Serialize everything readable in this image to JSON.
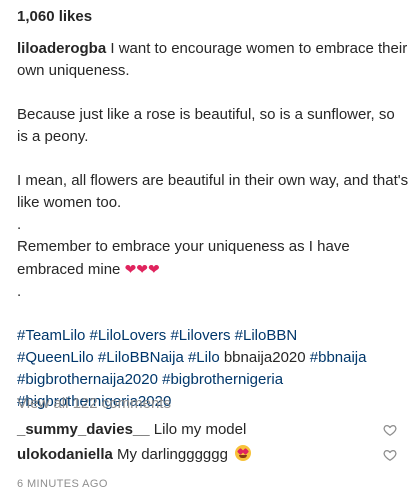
{
  "post": {
    "likes": "1,060 likes",
    "caption": {
      "username": "liloaderogba",
      "line1": " I want to encourage women to embrace their own uniqueness.",
      "line2": "Because just like a rose is beautiful, so is a sunflower, so is a peony.",
      "line3": "I mean, all flowers are beautiful in their own way, and that's like women too.",
      "dot1": ".",
      "line4": "Remember to embrace your uniqueness as I have embraced mine ",
      "hearts": "❤❤❤",
      "dot2": ".",
      "hashtags": [
        "#TeamLilo",
        "#LiloLovers",
        "#Lilovers",
        "#LiloBBN",
        "#QueenLilo",
        "#LiloBBNaija",
        "#Lilo",
        "bbnaija2020",
        "#bbnaija",
        "#bigbrothernaija2020",
        "#bigbrothernigeria",
        "#bigbrothernigeria2020"
      ]
    },
    "view_all_comments": "View all 122 comments",
    "comments": [
      {
        "username": "_summy_davies__",
        "text": "Lilo my model",
        "like_icon": "heart-outline-icon"
      },
      {
        "username": "ulokodaniella",
        "text": "My darlingggggg",
        "emoji": "smiling-face-with-heart-eyes",
        "like_icon": "heart-outline-icon"
      }
    ],
    "timestamp": "6 MINUTES AGO",
    "colors": {
      "hashtag": "#00376b",
      "muted": "#8e8e8e",
      "heart": "#e0245e"
    }
  }
}
